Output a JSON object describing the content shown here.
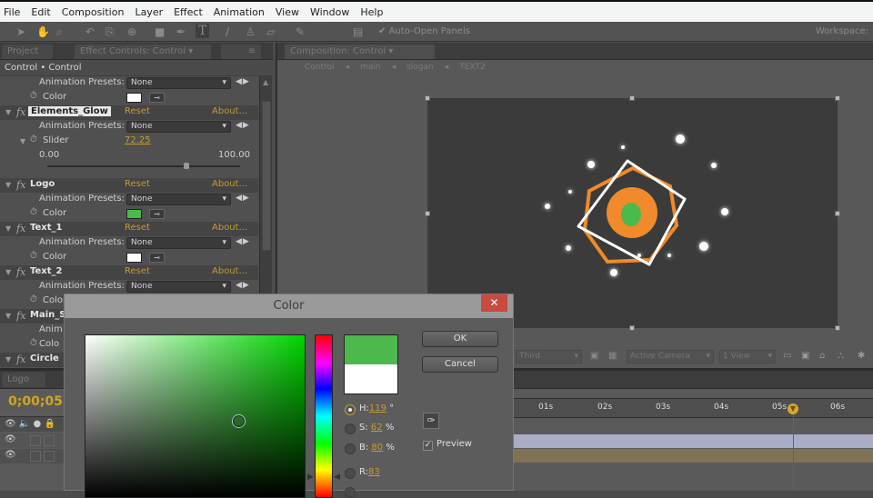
{
  "menu": [
    "File",
    "Edit",
    "Composition",
    "Layer",
    "Effect",
    "Animation",
    "View",
    "Window",
    "Help"
  ],
  "toolbar": {
    "auto_open_panels": "Auto-Open Panels",
    "workspace_label": "Workspace:"
  },
  "left_panel": {
    "tabs": {
      "project": "Project",
      "effect_controls": "Effect Controls: Control"
    },
    "breadcrumb": "Control • Control",
    "rows": [
      {
        "type": "prop",
        "label": "Animation Presets:",
        "value": "None"
      },
      {
        "type": "color",
        "label": "Color",
        "color": "#ffffff"
      },
      {
        "type": "fx",
        "name": "Elements_Glow",
        "selected": true,
        "reset": "Reset",
        "about": "About..."
      },
      {
        "type": "prop",
        "label": "Animation Presets:",
        "value": "None"
      },
      {
        "type": "slider",
        "label": "Slider",
        "value": "72.25",
        "min": "0.00",
        "max": "100.00",
        "fraction": 0.7225
      },
      {
        "type": "fx",
        "name": "Logo",
        "reset": "Reset",
        "about": "About..."
      },
      {
        "type": "prop",
        "label": "Animation Presets:",
        "value": "None"
      },
      {
        "type": "color",
        "label": "Color",
        "color": "#4cb94c"
      },
      {
        "type": "fx",
        "name": "Text_1",
        "reset": "Reset",
        "about": "About..."
      },
      {
        "type": "prop",
        "label": "Animation Presets:",
        "value": "None"
      },
      {
        "type": "color",
        "label": "Color",
        "color": "#ffffff"
      },
      {
        "type": "fx",
        "name": "Text_2",
        "reset": "Reset",
        "about": "About..."
      },
      {
        "type": "prop",
        "label": "Animation Presets:",
        "value": "None"
      },
      {
        "type": "color",
        "label": "Color",
        "color": "#333333"
      },
      {
        "type": "fx",
        "name": "Main_S",
        "reset": "",
        "about": ""
      },
      {
        "type": "text",
        "label": "Anim"
      },
      {
        "type": "text",
        "label": "Colo"
      },
      {
        "type": "fx",
        "name": "Circle",
        "reset": "",
        "about": ""
      }
    ]
  },
  "comp_panel": {
    "tab": "Composition: Control",
    "breadcrumb": [
      "Control",
      "main",
      "slogan",
      "TEXT2"
    ],
    "viewer": {
      "resolution": "Third",
      "camera": "Active Camera",
      "views": "1 View"
    }
  },
  "timeline": {
    "tab": "Logo",
    "timecode": "0;00;05",
    "ticks": [
      "01s",
      "02s",
      "03s",
      "04s",
      "05s",
      "06s"
    ]
  },
  "color_dialog": {
    "title": "Color",
    "close": "✕",
    "ok": "OK",
    "cancel": "Cancel",
    "new_color": "#4cb94c",
    "old_color": "#ffffff",
    "fields": [
      {
        "label": "H:",
        "value": "119",
        "unit": "°",
        "selected": true
      },
      {
        "label": "S:",
        "value": "62",
        "unit": "%",
        "selected": false
      },
      {
        "label": "B:",
        "value": "80",
        "unit": "%",
        "selected": false
      },
      {
        "label": "R:",
        "value": "83",
        "unit": "",
        "selected": false
      }
    ],
    "preview_label": "Preview",
    "preview_checked": true
  }
}
